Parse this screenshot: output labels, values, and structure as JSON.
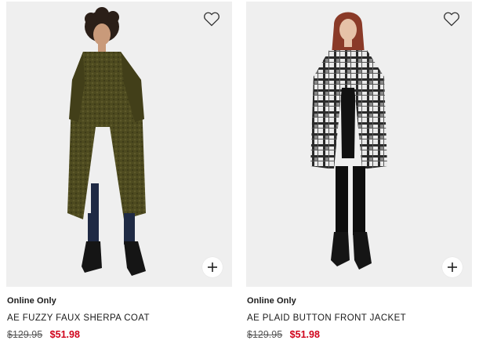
{
  "colors": {
    "sale": "#d0021b",
    "text": "#1a1a1a",
    "photo_background": "#efefef"
  },
  "products": [
    {
      "badge": "Online Only",
      "name": "AE FUZZY FAUX SHERPA COAT",
      "original_price": "$129.95",
      "sale_price": "$51.98",
      "wishlist_icon": "heart-outline-icon",
      "quick_add_icon": "plus-icon"
    },
    {
      "badge": "Online Only",
      "name": "AE PLAID BUTTON FRONT JACKET",
      "original_price": "$129.95",
      "sale_price": "$51.98",
      "wishlist_icon": "heart-outline-icon",
      "quick_add_icon": "plus-icon"
    }
  ]
}
